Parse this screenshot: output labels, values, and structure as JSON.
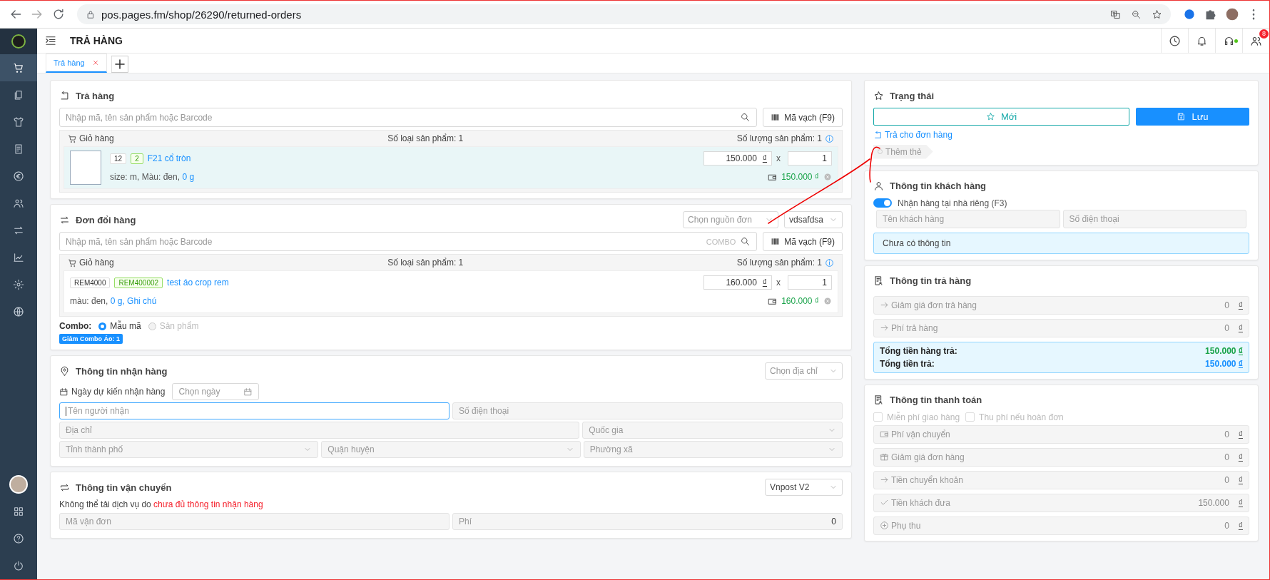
{
  "browser": {
    "url": "pos.pages.fm/shop/26290/returned-orders"
  },
  "sidebar": {
    "items": [
      {
        "kind": "cart",
        "selected": true
      },
      {
        "kind": "copy",
        "selected": false
      },
      {
        "kind": "shirt",
        "selected": false
      },
      {
        "kind": "report",
        "selected": false
      },
      {
        "kind": "euro",
        "selected": false
      },
      {
        "kind": "users",
        "selected": false
      },
      {
        "kind": "swap",
        "selected": false
      },
      {
        "kind": "chart",
        "selected": false
      },
      {
        "kind": "gear",
        "selected": false
      },
      {
        "kind": "globe",
        "selected": false
      }
    ],
    "bottom": [
      {
        "kind": "avatar"
      },
      {
        "kind": "grid"
      },
      {
        "kind": "help"
      },
      {
        "kind": "logout"
      }
    ]
  },
  "header": {
    "title": "TRẢ HÀNG",
    "notification_count": "8",
    "online": true
  },
  "tabs": [
    {
      "label": "Trả hàng",
      "selected": true
    }
  ],
  "return_card": {
    "title": "Trả hàng",
    "search_placeholder": "Nhập mã, tên sản phẩm hoặc Barcode",
    "barcode_button": "Mã vạch (F9)",
    "cart": {
      "title": "Giỏ hàng",
      "types": "Số loại sản phẩm: 1",
      "quantity": "Số lượng sản phẩm: 1",
      "items": [
        {
          "has_image": true,
          "highlighted": true,
          "code": "12",
          "variant": "2",
          "name": "F21 cổ tròn",
          "details": "size: m, Màu: đen,",
          "links": "0 g",
          "price": "150.000",
          "currency": "₫",
          "multiplier": "x",
          "qty": "1",
          "total": "150.000 ₫"
        }
      ]
    }
  },
  "exchange_card": {
    "title": "Đơn đổi hàng",
    "source_placeholder": "Chọn nguồn đơn",
    "page_select": "vdsafdsa",
    "search_placeholder": "Nhập mã, tên sản phẩm hoặc Barcode",
    "search_hint": "COMBO",
    "barcode_button": "Mã vạch (F9)",
    "cart": {
      "title": "Giỏ hàng",
      "types": "Số loại sản phẩm: 1",
      "quantity": "Số lượng sản phẩm: 1",
      "items": [
        {
          "has_image": false,
          "highlighted": false,
          "code": "REM4000",
          "variant": "REM400002",
          "name": "test áo crop rem",
          "details": "màu: đen,",
          "links": "0 g, Ghi chú",
          "price": "160.000",
          "currency": "₫",
          "multiplier": "x",
          "qty": "1",
          "total": "160.000 ₫"
        }
      ]
    },
    "combo": {
      "label": "Combo:",
      "options": [
        {
          "label": "Mẫu mã",
          "selected": true,
          "disabled": false
        },
        {
          "label": "Sản phẩm",
          "selected": false,
          "disabled": true
        }
      ],
      "tag": "Giảm Combo Áo: 1"
    }
  },
  "receive_card": {
    "title": "Thông tin nhận hàng",
    "address_select": "Chọn địa chỉ",
    "date_label": "Ngày dự kiến nhận hàng",
    "date_placeholder": "Chọn ngày",
    "recipient_field": {
      "placeholder": "Tên người nhận",
      "focused": true
    },
    "phone_field": {
      "placeholder": "Số điện thoại"
    },
    "address_field": {
      "placeholder": "Địa chỉ"
    },
    "country_select": {
      "placeholder": "Quốc gia"
    },
    "province_select": {
      "placeholder": "Tỉnh thành phố"
    },
    "district_select": {
      "placeholder": "Quận huyện"
    },
    "ward_select": {
      "placeholder": "Phường xã"
    }
  },
  "shipping_card": {
    "title": "Thông tin vận chuyển",
    "carrier": "Vnpost V2",
    "message": "Không thể tải dịch vụ do",
    "message_alert": "chưa đủ thông tin nhận hàng",
    "tracking_placeholder": "Mã vận đơn",
    "fee_placeholder": "Phí",
    "fee_value": "0"
  },
  "status_card": {
    "title": "Trạng thái",
    "new_button": "Mới",
    "save_button": "Lưu",
    "return_link": "Trả cho đơn hàng",
    "tag_button": "Thêm thẻ"
  },
  "customer_card": {
    "title": "Thông tin khách hàng",
    "toggle": {
      "label": "Nhận hàng tại nhà riêng (F3)",
      "on": true
    },
    "name_placeholder": "Tên khách hàng",
    "phone_placeholder": "Số điện thoại",
    "info": "Chưa có thông tin"
  },
  "return_info_card": {
    "title": "Thông tin trả hàng",
    "rows": [
      {
        "kind": "arrow",
        "label": "Giảm giá đơn trả hàng",
        "value": "0",
        "currency": "₫"
      },
      {
        "kind": "arrow",
        "label": "Phí trả hàng",
        "value": "0",
        "currency": "₫"
      }
    ],
    "totals": [
      {
        "label": "Tổng tiền hàng trả:",
        "value": "150.000",
        "currency": "₫",
        "color": "#1aa34a"
      },
      {
        "label": "Tổng tiền trả:",
        "value": "150.000",
        "currency": "₫",
        "color": "#1890ff"
      }
    ]
  },
  "payment_card": {
    "title": "Thông tin thanh toán",
    "checkboxes": [
      {
        "label": "Miễn phí giao hàng",
        "checked": false
      },
      {
        "label": "Thu phí nếu hoàn đơn",
        "checked": false
      }
    ],
    "rows": [
      {
        "kind": "wallet",
        "label": "Phí vận chuyển",
        "value": "0",
        "currency": "₫"
      },
      {
        "kind": "gift",
        "label": "Giảm giá đơn hàng",
        "value": "0",
        "currency": "₫"
      },
      {
        "kind": "arrow",
        "label": "Tiền chuyển khoản",
        "value": "0",
        "currency": "₫"
      },
      {
        "kind": "check",
        "label": "Tiền khách đưa",
        "value": "150.000",
        "currency": "₫"
      },
      {
        "kind": "plus",
        "label": "Phụ thu",
        "value": "0",
        "currency": "₫"
      }
    ]
  }
}
